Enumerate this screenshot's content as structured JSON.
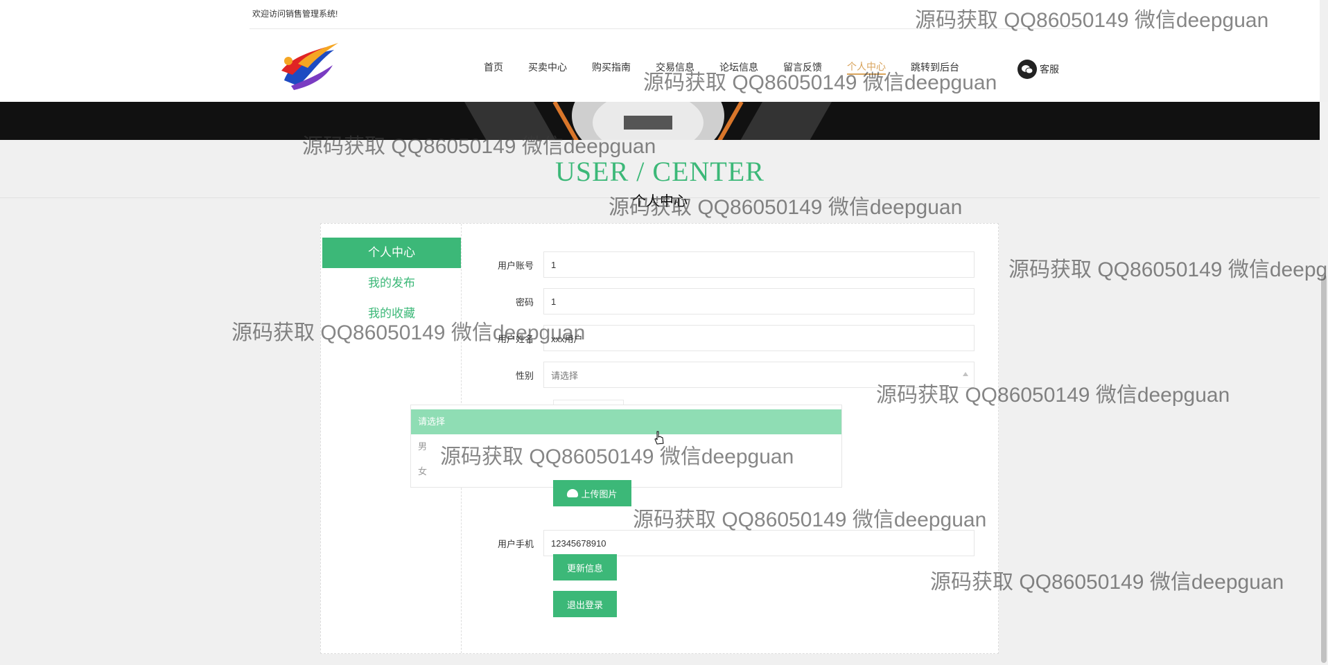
{
  "header": {
    "welcome": "欢迎访问销售管理系统!",
    "nav": [
      "首页",
      "买卖中心",
      "购买指南",
      "交易信息",
      "论坛信息",
      "留言反馈",
      "个人中心",
      "跳转到后台"
    ],
    "service": "客服",
    "active_index": 6
  },
  "title": {
    "en": "USER / CENTER",
    "zh": "个人中心"
  },
  "sidebar": {
    "items": [
      "个人中心",
      "我的发布",
      "我的收藏"
    ]
  },
  "form": {
    "account": {
      "label": "用户账号",
      "value": "1"
    },
    "password": {
      "label": "密码",
      "value": "1"
    },
    "name": {
      "label": "用户姓名",
      "value": "xxx用户"
    },
    "gender": {
      "label": "性别",
      "value": "请选择",
      "options": [
        "请选择",
        "男",
        "女"
      ]
    },
    "upload_label": "上传图片",
    "phone": {
      "label": "用户手机",
      "value": "12345678910"
    },
    "update_label": "更新信息",
    "logout_label": "退出登录"
  },
  "watermark": "源码获取 QQ86050149 微信deepguan",
  "colors": {
    "accent": "#3cb878",
    "nav_active": "#d8a35b",
    "dropdown_hover": "#8fddb4"
  }
}
